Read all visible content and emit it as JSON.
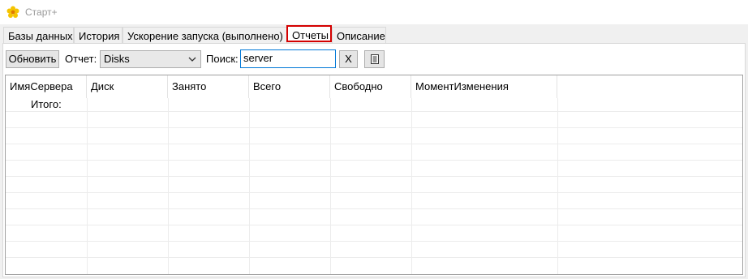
{
  "window": {
    "title": "Старт+",
    "icon": "flower-icon"
  },
  "tabs": [
    {
      "label": "Базы данных",
      "active": false
    },
    {
      "label": "История",
      "active": false
    },
    {
      "label": "Ускорение запуска (выполнено)",
      "active": false
    },
    {
      "label": "Отчеты",
      "active": true
    },
    {
      "label": "Описание",
      "active": false
    }
  ],
  "toolbar": {
    "refresh_label": "Обновить",
    "report_label": "Отчет:",
    "report_value": "Disks",
    "search_label": "Поиск:",
    "search_value": "server",
    "clear_label": "X",
    "export_icon": "document-icon"
  },
  "grid": {
    "columns": [
      "ИмяСервера",
      "Диск",
      "Занято",
      "Всего",
      "Свободно",
      "МоментИзменения"
    ],
    "total_label": "Итого:"
  },
  "colors": {
    "active_tab_border": "#d40000",
    "focus_border": "#0078d7"
  }
}
